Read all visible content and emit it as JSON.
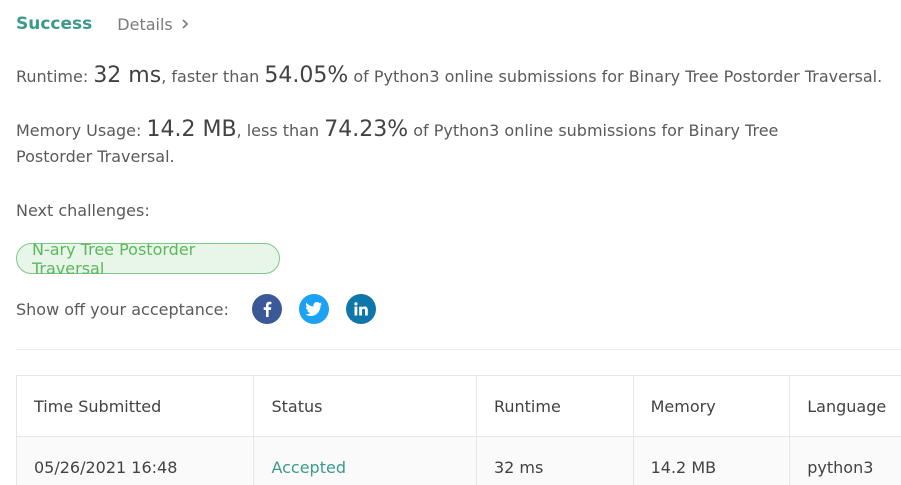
{
  "tabs": {
    "success": "Success",
    "details": "Details"
  },
  "runtime": {
    "label": "Runtime: ",
    "value": "32 ms",
    "mid": ", faster than ",
    "percent": "54.05%",
    "tail": " of Python3 online submissions for Binary Tree Postorder Traversal."
  },
  "memory": {
    "label": "Memory Usage: ",
    "value": "14.2 MB",
    "mid": ", less than ",
    "percent": "74.23%",
    "tail": " of Python3 online submissions for Binary Tree Postorder Traversal."
  },
  "next": {
    "label": "Next challenges:",
    "chip": "N-ary Tree Postorder Traversal"
  },
  "share": {
    "label": "Show off your acceptance:",
    "icons": [
      "facebook-icon",
      "twitter-icon",
      "linkedin-icon"
    ]
  },
  "table": {
    "headers": [
      "Time Submitted",
      "Status",
      "Runtime",
      "Memory",
      "Language"
    ],
    "rows": [
      [
        "05/26/2021 16:48",
        "Accepted",
        "32 ms",
        "14.2 MB",
        "python3"
      ]
    ]
  },
  "colors": {
    "accent": "#3c9a8c",
    "chip_border": "#7cc98a",
    "chip_bg": "#e8f5e9",
    "facebook": "#3b5998",
    "twitter": "#1da1f2",
    "linkedin": "#0e76a8"
  }
}
